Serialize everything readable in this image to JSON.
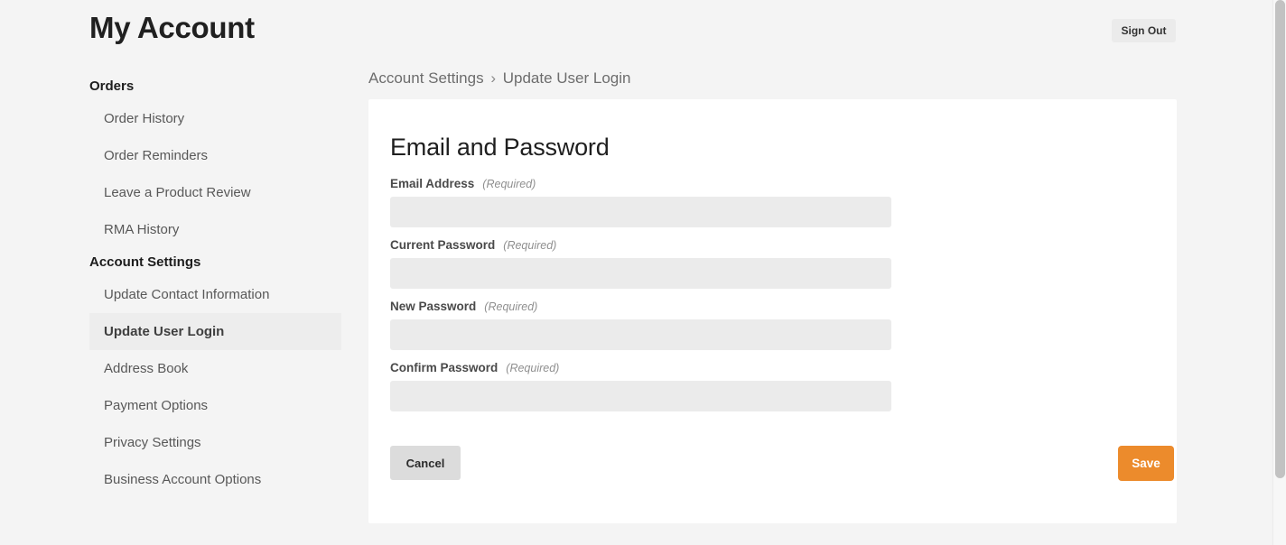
{
  "header": {
    "title": "My Account",
    "sign_out_label": "Sign Out"
  },
  "sidebar": {
    "groups": [
      {
        "heading": "Orders",
        "items": [
          {
            "label": "Order History",
            "active": false
          },
          {
            "label": "Order Reminders",
            "active": false
          },
          {
            "label": "Leave a Product Review",
            "active": false
          },
          {
            "label": "RMA History",
            "active": false
          }
        ]
      },
      {
        "heading": "Account Settings",
        "items": [
          {
            "label": "Update Contact Information",
            "active": false
          },
          {
            "label": "Update User Login",
            "active": true
          },
          {
            "label": "Address Book",
            "active": false
          },
          {
            "label": "Payment Options",
            "active": false
          },
          {
            "label": "Privacy Settings",
            "active": false
          },
          {
            "label": "Business Account Options",
            "active": false
          }
        ]
      }
    ]
  },
  "breadcrumb": {
    "parent": "Account Settings",
    "separator": "›",
    "current": "Update User Login"
  },
  "card": {
    "title": "Email and Password",
    "required_note": "(Required)",
    "fields": [
      {
        "label": "Email Address",
        "required_note": "(Required)",
        "value": "",
        "placeholder": ""
      },
      {
        "label": "Current Password",
        "required_note": "(Required)",
        "value": "",
        "placeholder": ""
      },
      {
        "label": "New Password",
        "required_note": "(Required)",
        "value": "",
        "placeholder": ""
      },
      {
        "label": "Confirm Password",
        "required_note": "(Required)",
        "value": "",
        "placeholder": ""
      }
    ],
    "cancel_label": "Cancel",
    "save_label": "Save"
  },
  "colors": {
    "page_background": "#f4f4f4",
    "card_background": "#ffffff",
    "accent": "#ec8b2c",
    "input_background": "#ebebeb",
    "active_nav_background": "#ededed"
  }
}
